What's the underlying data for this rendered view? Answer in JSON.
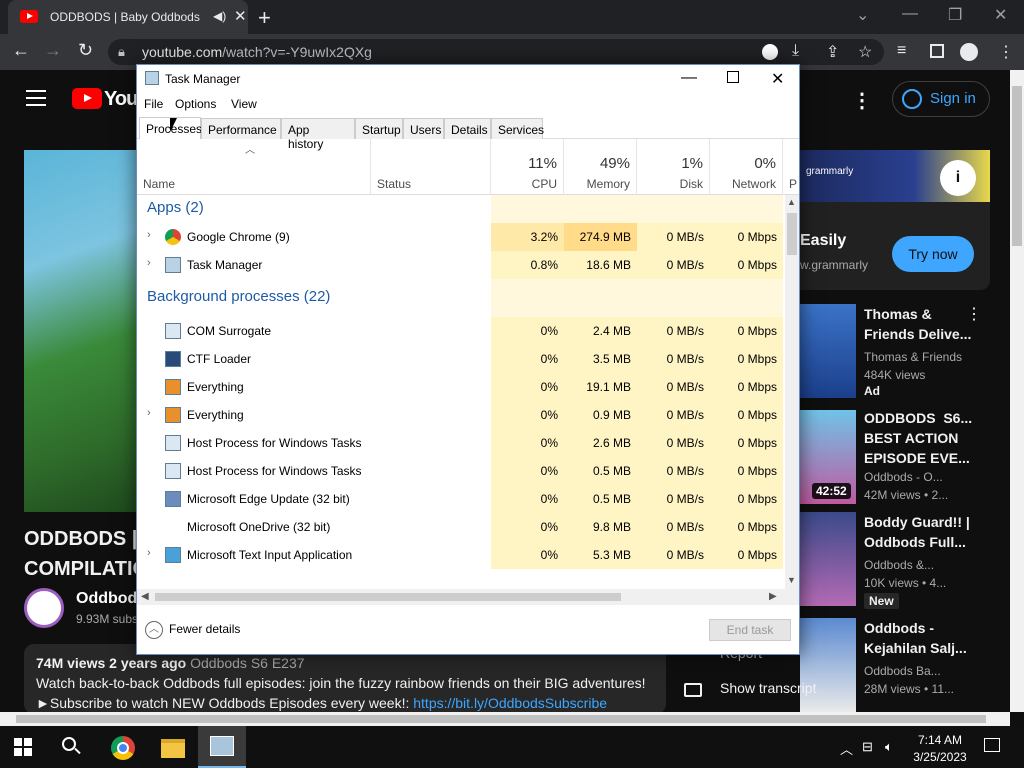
{
  "browser": {
    "tab_title": "ODDBODS | Baby Oddbods",
    "tab_close": "✕",
    "new_tab": "+",
    "url_domain": "youtube.com",
    "url_path": "/watch?v=-Y9uwIx2QXg",
    "win_min": "—",
    "win_restore": "❐",
    "win_close": "✕"
  },
  "youtube": {
    "logo_text": "YouT",
    "sign_in": "Sign in",
    "video_title": "ODDBODS | B\nCOMPILATIO",
    "channel_name": "Oddbods",
    "channel_subs": "9.93M subs",
    "views": "74M views",
    "age": "2 years ago",
    "tags": "Oddbods  S6 E237",
    "desc_line1": "Watch back-to-back Oddbods full episodes: join the fuzzy rainbow friends on their BIG adventures!",
    "desc_line2_prefix": "►Subscribe to watch NEW Oddbods Episodes every week!:",
    "desc_link": "https://bit.ly/OddbodsSubscribe",
    "ad_brand": "grammarly",
    "ad_headline": "Easily",
    "ad_url": "w.grammarly",
    "ad_cta": "Try now",
    "report": "Report",
    "transcript": "Show transcript",
    "recs": [
      {
        "title": "Thomas &\nFriends Delive...",
        "meta": "Thomas & Friends\n484K views",
        "badge": "Ad"
      },
      {
        "title": "ODDBODS  S6...\nBEST ACTION\nEPISODE EVE...",
        "meta": "Oddbods - O...\n42M views • 2...",
        "duration": "42:52"
      },
      {
        "title": "Boddy Guard!! |\nOddbods Full...",
        "meta": "Oddbods &...\n10K views • 4...",
        "badge": "New"
      },
      {
        "title": "Oddbods -\nKejahilan Salj...",
        "meta": "Oddbods Ba...\n28M views • 11..."
      }
    ]
  },
  "taskmanager": {
    "title": "Task Manager",
    "menu": [
      "File",
      "Options",
      "View"
    ],
    "tabs": [
      "Processes",
      "Performance",
      "App history",
      "Startup",
      "Users",
      "Details",
      "Services"
    ],
    "columns": {
      "name": "Name",
      "status": "Status",
      "cpu_pct": "11%",
      "cpu": "CPU",
      "mem_pct": "49%",
      "mem": "Memory",
      "disk_pct": "1%",
      "disk": "Disk",
      "net_pct": "0%",
      "net": "Network",
      "extra": "P"
    },
    "groups": {
      "apps": "Apps (2)",
      "background": "Background processes (22)"
    },
    "apps": [
      {
        "name": "Google Chrome (9)",
        "cpu": "3.2%",
        "mem": "274.9 MB",
        "disk": "0 MB/s",
        "net": "0 Mbps"
      },
      {
        "name": "Task Manager",
        "cpu": "0.8%",
        "mem": "18.6 MB",
        "disk": "0 MB/s",
        "net": "0 Mbps"
      }
    ],
    "background": [
      {
        "name": "COM Surrogate",
        "cpu": "0%",
        "mem": "2.4 MB",
        "disk": "0 MB/s",
        "net": "0 Mbps"
      },
      {
        "name": "CTF Loader",
        "cpu": "0%",
        "mem": "3.5 MB",
        "disk": "0 MB/s",
        "net": "0 Mbps"
      },
      {
        "name": "Everything",
        "cpu": "0%",
        "mem": "19.1 MB",
        "disk": "0 MB/s",
        "net": "0 Mbps"
      },
      {
        "name": "Everything",
        "cpu": "0%",
        "mem": "0.9 MB",
        "disk": "0 MB/s",
        "net": "0 Mbps"
      },
      {
        "name": "Host Process for Windows Tasks",
        "cpu": "0%",
        "mem": "2.6 MB",
        "disk": "0 MB/s",
        "net": "0 Mbps"
      },
      {
        "name": "Host Process for Windows Tasks",
        "cpu": "0%",
        "mem": "0.5 MB",
        "disk": "0 MB/s",
        "net": "0 Mbps"
      },
      {
        "name": "Microsoft Edge Update (32 bit)",
        "cpu": "0%",
        "mem": "0.5 MB",
        "disk": "0 MB/s",
        "net": "0 Mbps"
      },
      {
        "name": "Microsoft OneDrive (32 bit)",
        "cpu": "0%",
        "mem": "9.8 MB",
        "disk": "0 MB/s",
        "net": "0 Mbps"
      },
      {
        "name": "Microsoft Text Input Application",
        "cpu": "0%",
        "mem": "5.3 MB",
        "disk": "0 MB/s",
        "net": "0 Mbps"
      }
    ],
    "fewer_details": "Fewer details",
    "end_task": "End task"
  },
  "taskbar": {
    "time": "7:14 AM",
    "date": "3/25/2023"
  },
  "colors": {
    "cpu_high": "#ffe9a8",
    "cell_light": "#fff8dc",
    "youtube_red": "#ff0000",
    "link_blue": "#3ea6ff"
  }
}
